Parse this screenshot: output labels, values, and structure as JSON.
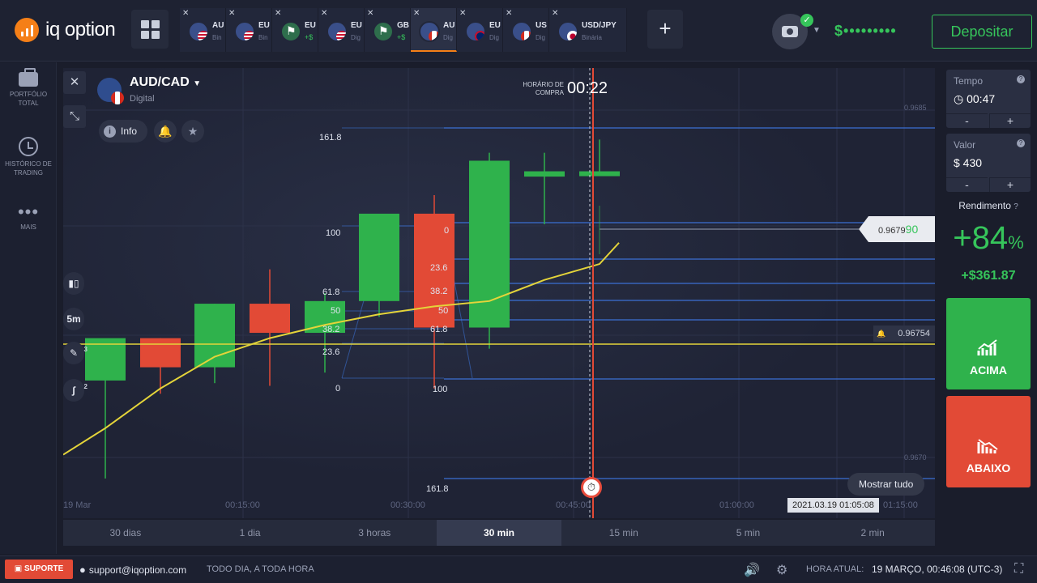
{
  "header": {
    "logo_text": "iq option",
    "tabs": [
      {
        "symbol": "AU",
        "type": "Bin",
        "flag": "f-us",
        "percent": ""
      },
      {
        "symbol": "EU",
        "type": "Bin",
        "flag": "f-us",
        "percent": ""
      },
      {
        "symbol": "EU",
        "type": "",
        "flag": "f-chk",
        "percent": "+$"
      },
      {
        "symbol": "EU",
        "type": "Dig",
        "flag": "f-us",
        "percent": ""
      },
      {
        "symbol": "GB",
        "type": "",
        "flag": "f-chk",
        "percent": "+$"
      },
      {
        "symbol": "AU",
        "type": "Dig",
        "flag": "f-ca",
        "percent": ""
      },
      {
        "symbol": "EU",
        "type": "Dig",
        "flag": "f-gb",
        "percent": ""
      },
      {
        "symbol": "US",
        "type": "Dig",
        "flag": "f-ca",
        "percent": ""
      },
      {
        "symbol": "USD/JPY",
        "type": "Binária",
        "flag": "f-jp",
        "percent": ""
      }
    ],
    "add_tab": "+",
    "balance": "$•••••••••",
    "deposit_label": "Depositar"
  },
  "sidebar": {
    "items": [
      {
        "label": "PORTFÓLIO TOTAL"
      },
      {
        "label": "HISTÓRICO DE TRADING"
      },
      {
        "label": "MAIS"
      }
    ]
  },
  "asset": {
    "name": "AUD/CAD",
    "type": "Digital",
    "info_label": "Info"
  },
  "chart_overlay": {
    "purchase_label": "HORÁRIO DE COMPRA",
    "purchase_time": "00:22",
    "current_price_main": "0.9679",
    "current_price_tail": "90",
    "level_price": "0.96754",
    "show_all": "Mostrar tudo",
    "current_time_tag": "2021.03.19 01:05:08",
    "tools": {
      "candle_count": "",
      "timeframe": "5m",
      "draw_badge": "3",
      "indicator_badge": "2"
    }
  },
  "chart_data": {
    "type": "candlestick",
    "title": "AUD/CAD",
    "x_tick_labels": [
      "19 Mar",
      "00:15:00",
      "00:30:00",
      "00:45:00",
      "01:00:00",
      "01:15:00"
    ],
    "y_tick_labels": [
      "0.9685",
      "0.9670"
    ],
    "fib_labels_left": [
      "161.8",
      "100",
      "61.8",
      "50",
      "38.2",
      "23.6",
      "0"
    ],
    "fib_labels_right": [
      "0",
      "23.6",
      "38.2",
      "50",
      "61.8",
      "100",
      "161.8"
    ],
    "candles": [
      {
        "o": 0.96742,
        "h": 0.96744,
        "l": 0.96705,
        "c": 0.96758,
        "dir": "up"
      },
      {
        "o": 0.96758,
        "h": 0.96758,
        "l": 0.96737,
        "c": 0.96747,
        "dir": "down"
      },
      {
        "o": 0.96747,
        "h": 0.96771,
        "l": 0.96741,
        "c": 0.96771,
        "dir": "up"
      },
      {
        "o": 0.96771,
        "h": 0.96784,
        "l": 0.9674,
        "c": 0.9676,
        "dir": "down"
      },
      {
        "o": 0.9676,
        "h": 0.96775,
        "l": 0.96745,
        "c": 0.96772,
        "dir": "up"
      },
      {
        "o": 0.96772,
        "h": 0.96804,
        "l": 0.96766,
        "c": 0.96805,
        "dir": "up"
      },
      {
        "o": 0.96805,
        "h": 0.96812,
        "l": 0.96739,
        "c": 0.96762,
        "dir": "down"
      },
      {
        "o": 0.96762,
        "h": 0.96828,
        "l": 0.96754,
        "c": 0.96825,
        "dir": "up"
      },
      {
        "o": 0.96821,
        "h": 0.96828,
        "l": 0.96801,
        "c": 0.96819,
        "dir": "up"
      },
      {
        "o": 0.9682,
        "h": 0.96833,
        "l": 0.9682,
        "c": 0.96821,
        "dir": "up"
      }
    ],
    "ylim": [
      0.9669,
      0.9686
    ],
    "moving_average": [
      0.96724,
      0.96739,
      0.96751,
      0.96758,
      0.96763,
      0.96767,
      0.9677,
      0.96772,
      0.9678,
      0.96786
    ],
    "series_colors": {
      "up": "#2fb24c",
      "down": "#e24a36",
      "ma": "#e4d43a",
      "fib": "#3b6fd1",
      "expiry": "#e24a36"
    }
  },
  "timeframes": [
    {
      "label": "30 dias",
      "active": false
    },
    {
      "label": "1 dia",
      "active": false
    },
    {
      "label": "3 horas",
      "active": false
    },
    {
      "label": "30 min",
      "active": true
    },
    {
      "label": "15 min",
      "active": false
    },
    {
      "label": "5 min",
      "active": false
    },
    {
      "label": "2 min",
      "active": false
    }
  ],
  "right_panel": {
    "time_label": "Tempo",
    "time_value": "00:47",
    "amount_label": "Valor",
    "amount_value": "$ 430",
    "minus": "-",
    "plus": "+",
    "yield_label": "Rendimento",
    "yield_pct": "+84",
    "yield_pct_sign": "%",
    "yield_amount": "+$361.87",
    "up_label": "ACIMA",
    "down_label": "ABAIXO"
  },
  "footer": {
    "support_label": "SUPORTE",
    "email": "support@iqoption.com",
    "tagline": "TODO DIA, A TODA HORA",
    "clock_label": "HORA ATUAL:",
    "clock_value": "19 MARÇO, 00:46:08 (UTC-3)"
  }
}
